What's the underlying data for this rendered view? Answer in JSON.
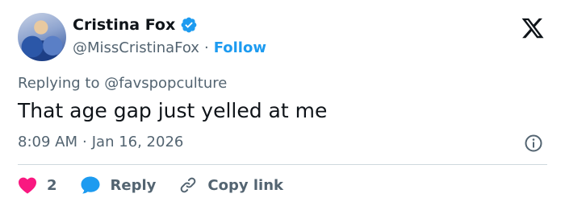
{
  "user": {
    "display_name": "Cristina Fox",
    "handle": "@MissCristinaFox",
    "separator": "·",
    "follow_label": "Follow"
  },
  "tweet": {
    "replying_to": "Replying to @favspopculture",
    "text": "That age gap just yelled at me",
    "time": "8:09 AM",
    "separator": "·",
    "date": "Jan 16, 2026"
  },
  "actions": {
    "like_count": "2",
    "reply_label": "Reply",
    "copy_link_label": "Copy link"
  },
  "icons": {
    "verified": "verified-badge-icon",
    "x_logo": "x-logo-icon",
    "info": "info-icon",
    "heart": "heart-icon",
    "reply": "chat-bubble-icon",
    "link": "link-icon"
  },
  "colors": {
    "accent": "#1d9bf0",
    "like": "#f91880",
    "muted_text": "#536471",
    "text": "#0f1419",
    "divider": "#cfd9de"
  }
}
